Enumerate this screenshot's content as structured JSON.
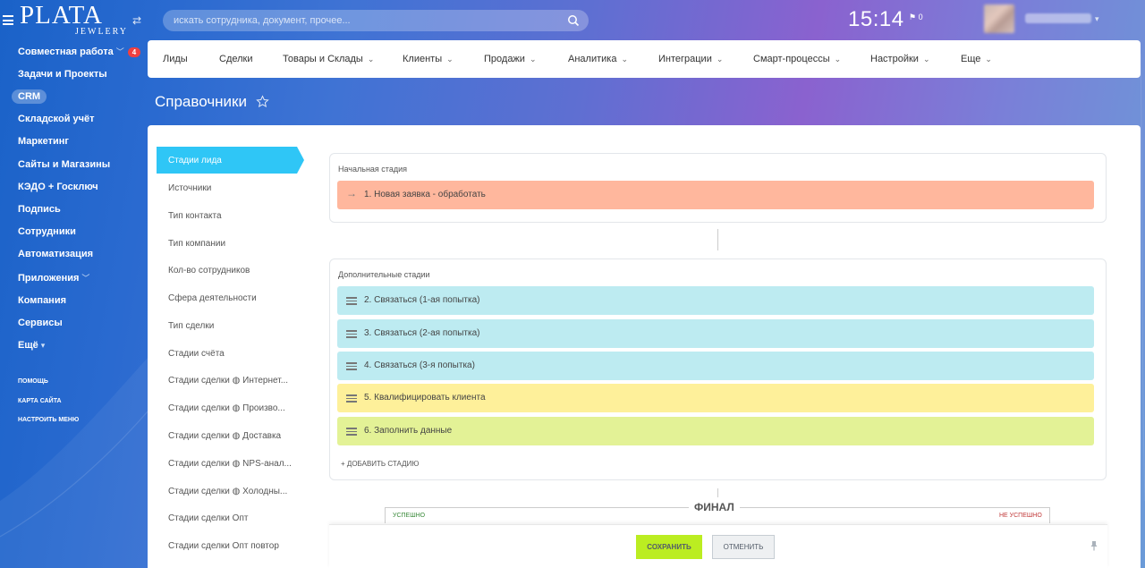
{
  "header": {
    "logo_text": "PLATA",
    "logo_sub": "JEWLERY",
    "search_placeholder": "искать сотрудника, документ, прочее...",
    "clock": "15:14",
    "flag_count": "0"
  },
  "sidebar": {
    "items": [
      {
        "label": "Совместная работа",
        "badge": "4",
        "chevron": true
      },
      {
        "label": "Задачи и Проекты"
      },
      {
        "label": "CRM",
        "active": true
      },
      {
        "label": "Складской учёт"
      },
      {
        "label": "Маркетинг"
      },
      {
        "label": "Сайты и Магазины"
      },
      {
        "label": "КЭДО + Госключ"
      },
      {
        "label": "Подпись"
      },
      {
        "label": "Сотрудники"
      },
      {
        "label": "Автоматизация"
      },
      {
        "label": "Приложения",
        "chevron": true
      },
      {
        "label": "Компания"
      },
      {
        "label": "Сервисы"
      },
      {
        "label": "Ещё",
        "chevron": true
      }
    ],
    "footer_links": [
      "ПОМОЩЬ",
      "КАРТА САЙТА",
      "НАСТРОИТЬ МЕНЮ"
    ]
  },
  "topmenu": {
    "items": [
      {
        "label": "Лиды"
      },
      {
        "label": "Сделки"
      },
      {
        "label": "Товары и Склады",
        "chevron": true
      },
      {
        "label": "Клиенты",
        "chevron": true
      },
      {
        "label": "Продажи",
        "chevron": true
      },
      {
        "label": "Аналитика",
        "chevron": true
      },
      {
        "label": "Интеграции",
        "chevron": true
      },
      {
        "label": "Смарт-процессы",
        "chevron": true
      },
      {
        "label": "Настройки",
        "chevron": true
      },
      {
        "label": "Еще",
        "chevron": true
      }
    ]
  },
  "page_title": "Справочники",
  "references": {
    "active": "Стадии лида",
    "items": [
      "Источники",
      "Тип контакта",
      "Тип компании",
      "Кол-во сотрудников",
      "Сфера деятельности",
      "Тип сделки",
      "Стадии счёта",
      "Стадии сделки ◍ Интернет...",
      "Стадии сделки ◍ Произво...",
      "Стадии сделки ◍ Доставка",
      "Стадии сделки ◍ NPS-анал...",
      "Стадии сделки ◍ Холодны...",
      "Стадии сделки Опт",
      "Стадии сделки Опт повтор"
    ]
  },
  "stages": {
    "initial_label": "Начальная стадия",
    "initial": {
      "label": "1. Новая заявка - обработать",
      "color": "#ffb79d"
    },
    "extra_label": "Дополнительные стадии",
    "extra": [
      {
        "label": "2. Связаться (1-ая попытка)",
        "color": "#bdebf1"
      },
      {
        "label": "3. Связаться (2-ая попытка)",
        "color": "#bdebf1"
      },
      {
        "label": "4. Связаться (3-я попытка)",
        "color": "#bdebf1"
      },
      {
        "label": "5. Квалифицировать клиента",
        "color": "#fef09a"
      },
      {
        "label": "6. Заполнить данные",
        "color": "#e3f296"
      }
    ],
    "add_stage": "+ ДОБАВИТЬ СТАДИЮ",
    "final_label": "ФИНАЛ",
    "success": "УСПЕШНО",
    "failure": "НЕ УСПЕШНО"
  },
  "footer": {
    "save": "СОХРАНИТЬ",
    "cancel": "ОТМЕНИТЬ"
  },
  "colors": {
    "accent": "#2fc6f6",
    "save_button": "#bbed21"
  }
}
